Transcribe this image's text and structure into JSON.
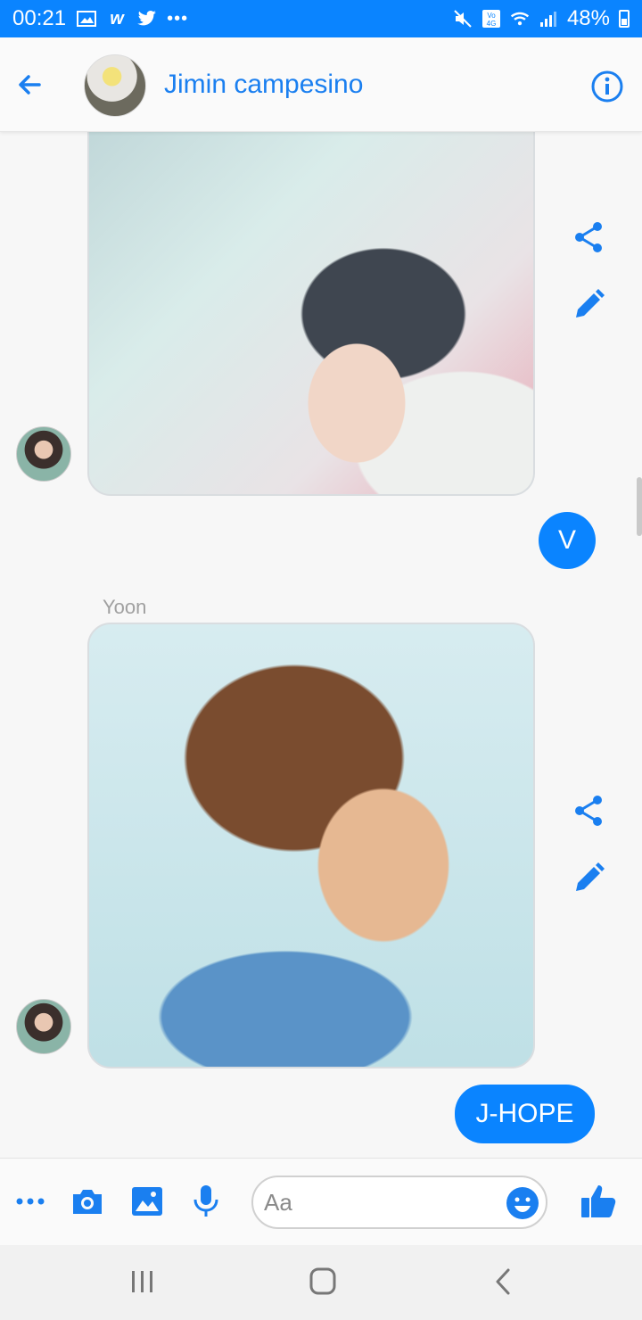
{
  "status_bar": {
    "time": "00:21",
    "left_icons": [
      "gallery-icon",
      "w-icon",
      "twitter-icon",
      "more-dots-icon"
    ],
    "right_icons": [
      "mute-icon",
      "volte-4g-icon",
      "wifi-icon",
      "signal-icon"
    ],
    "battery": "48%",
    "bg_color": "#0a84ff"
  },
  "header": {
    "contact_name": "Jimin campesino",
    "accent_color": "#1a7ff0"
  },
  "messages": {
    "first_photo_caption": "V",
    "sender_label": "Yoon",
    "second_photo_caption": "J-HOPE"
  },
  "composer": {
    "placeholder": "Aa"
  },
  "nav": {
    "buttons": [
      "recents-icon",
      "home-icon",
      "back-icon"
    ]
  }
}
